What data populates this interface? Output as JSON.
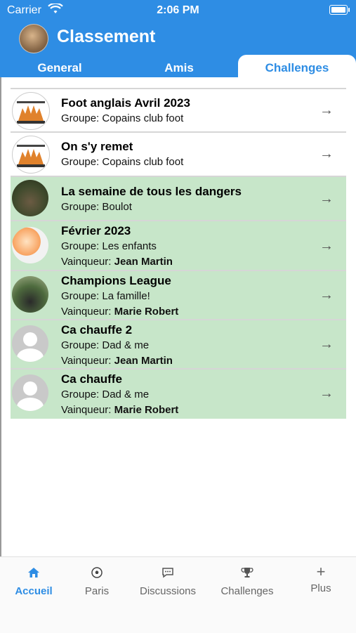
{
  "status": {
    "carrier": "Carrier",
    "time": "2:06 PM"
  },
  "header": {
    "title": "Classement"
  },
  "tabs": {
    "general": "General",
    "amis": "Amis",
    "challenges": "Challenges",
    "active": "challenges"
  },
  "colors": {
    "accent": "#2e8de4",
    "won_row": "#c7e6c9"
  },
  "challenges": [
    {
      "name": "Foot anglais Avril 2023",
      "group": "Groupe: Copains club foot",
      "winner_label": "",
      "winner": "",
      "avatar": "fox-team-icon",
      "won": false
    },
    {
      "name": "On s'y remet",
      "group": "Groupe: Copains club foot",
      "winner_label": "",
      "winner": "",
      "avatar": "fox-team-icon",
      "won": false
    },
    {
      "name": "La semaine de tous les dangers",
      "group": "Groupe: Boulot",
      "winner_label": "",
      "winner": "",
      "avatar": "photo-avatar",
      "won": true
    },
    {
      "name": "Février 2023",
      "group": "Groupe: Les enfants",
      "winner_label": "Vainqueur: ",
      "winner": "Jean Martin",
      "avatar": "kids-avatar",
      "won": true
    },
    {
      "name": "Champions League",
      "group": "Groupe: La famille!",
      "winner_label": "Vainqueur: ",
      "winner": "Marie Robert",
      "avatar": "birds-avatar",
      "won": true
    },
    {
      "name": "Ca chauffe 2",
      "group": "Groupe: Dad & me",
      "winner_label": "Vainqueur: ",
      "winner": "Jean Martin",
      "avatar": "default-user-icon",
      "won": true
    },
    {
      "name": "Ca chauffe",
      "group": "Groupe: Dad & me",
      "winner_label": "Vainqueur: ",
      "winner": "Marie Robert",
      "avatar": "default-user-icon",
      "won": true
    }
  ],
  "tabbar": {
    "items": [
      {
        "label": "Accueil",
        "icon": "home-icon",
        "glyph": "⌂",
        "active": true
      },
      {
        "label": "Paris",
        "icon": "soccer-ball-icon",
        "glyph": "⚽",
        "active": false
      },
      {
        "label": "Discussions",
        "icon": "chat-bubble-icon",
        "glyph": "💬",
        "active": false
      },
      {
        "label": "Challenges",
        "icon": "trophy-icon",
        "glyph": "🏆",
        "active": false
      },
      {
        "label": "Plus",
        "icon": "plus-icon",
        "glyph": "+",
        "active": false
      }
    ]
  }
}
